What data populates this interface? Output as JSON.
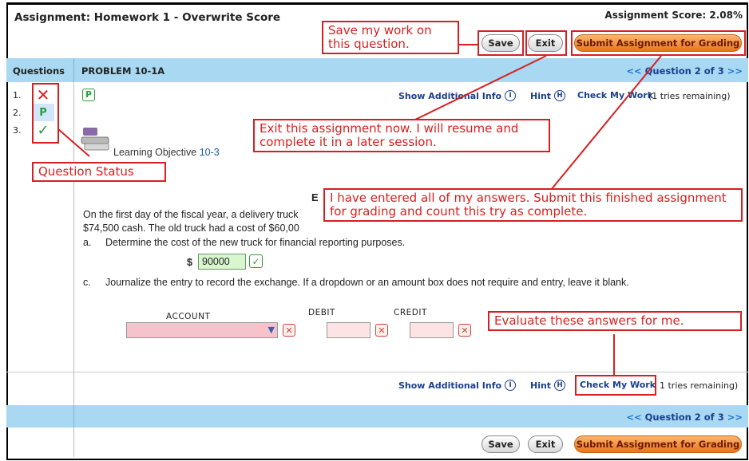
{
  "header": {
    "title": "Assignment: Homework 1 - Overwrite Score",
    "score": "Assignment Score: 2.08%",
    "save_label": "Save",
    "exit_label": "Exit",
    "submit_label": "Submit Assignment for Grading"
  },
  "nav": {
    "questions_label": "Questions",
    "problem_title": "PROBLEM 10-1A",
    "prev_arrows": "<<",
    "question_position": "Question 2 of 3",
    "next_arrows": ">>"
  },
  "questions": [
    {
      "num": "1.",
      "status": "✕",
      "status_color": "#d81f1f"
    },
    {
      "num": "2.",
      "status": "P",
      "status_color": "#2a9d3a"
    },
    {
      "num": "3.",
      "status": "✓",
      "status_color": "#2a9d3a"
    }
  ],
  "toolbar": {
    "p_badge": "P",
    "show_info_label": "Show Additional Info",
    "show_info_icon": "I",
    "hint_label": "Hint",
    "hint_icon": "H",
    "check_label": "Check My Work",
    "tries_remaining": "(1 tries remaining)",
    "tries_remaining_bottom": "1 tries remaining)"
  },
  "problem": {
    "objective_label": "Learning Objective",
    "objective_num": "10-3",
    "heading_initial": "E",
    "para_line1": "On the first day of the fiscal year, a delivery truck",
    "para_line2": "$74,500 cash.  The old truck had a cost of $60,00",
    "item_a_marker": "a.",
    "item_a_text": "Determine the cost of the new truck for financial reporting purposes.",
    "currency": "$",
    "cost_value": "90000",
    "item_c_marker": "c.",
    "item_c_text": "Journalize the entry to record the exchange.  If a dropdown or an amount box does not require and entry, leave it blank.",
    "account_header": "ACCOUNT",
    "debit_header": "DEBIT",
    "credit_header": "CREDIT"
  },
  "callouts": {
    "save": "Save my work on this question.",
    "exit": "Exit this assignment now. I will resume and complete it in a later session.",
    "status": "Question Status",
    "submit": "I have entered all of my answers. Submit this finished assignment for grading and count this try as complete.",
    "evaluate": "Evaluate these answers for me."
  },
  "colors": {
    "accent_orange": "#e8751d",
    "band_blue": "#a8d8f2",
    "link_blue": "#1a3f8f",
    "callout_red": "#d81f1f",
    "correct_green": "#2a9d3a"
  }
}
